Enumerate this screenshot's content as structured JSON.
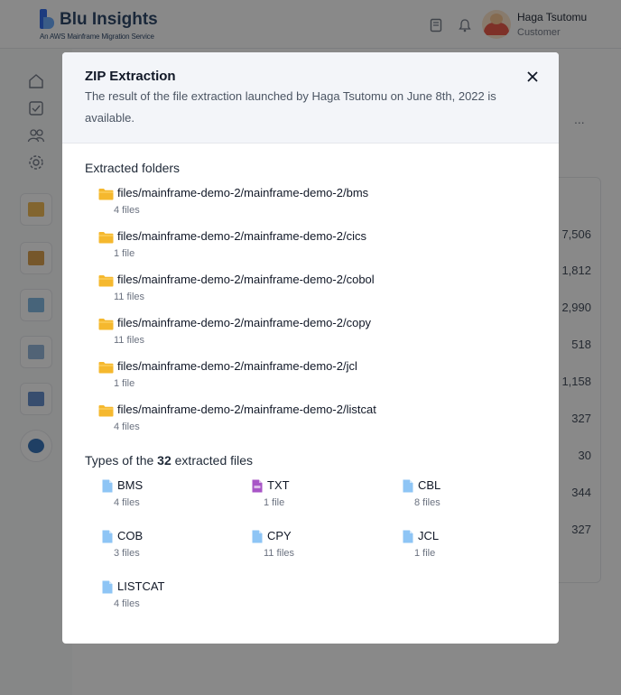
{
  "app": {
    "brand_title": "Blu Insights",
    "brand_subtitle": "An AWS Mainframe Migration Service",
    "user_name": "Haga Tsutomu",
    "user_role": "Customer",
    "background_values": [
      "7,506",
      "1,812",
      "2,990",
      "518",
      "1,158",
      "327",
      "30",
      "344",
      "327"
    ],
    "more_menu": "..."
  },
  "modal": {
    "title": "ZIP Extraction",
    "description": "The result of the file extraction launched by Haga Tsutomu on June 8th, 2022 is available.",
    "close_label": "×",
    "folders_title": "Extracted folders",
    "folders": [
      {
        "path": "files/mainframe-demo-2/mainframe-demo-2/bms",
        "count": "4 files"
      },
      {
        "path": "files/mainframe-demo-2/mainframe-demo-2/cics",
        "count": "1 file"
      },
      {
        "path": "files/mainframe-demo-2/mainframe-demo-2/cobol",
        "count": "11 files"
      },
      {
        "path": "files/mainframe-demo-2/mainframe-demo-2/copy",
        "count": "11 files"
      },
      {
        "path": "files/mainframe-demo-2/mainframe-demo-2/jcl",
        "count": "1 file"
      },
      {
        "path": "files/mainframe-demo-2/mainframe-demo-2/listcat",
        "count": "4 files"
      }
    ],
    "types_title_prefix": "Types of the",
    "types_total": "32",
    "types_title_suffix": "extracted files",
    "types": [
      {
        "name": "BMS",
        "count": "4 files",
        "icon": "file-icon"
      },
      {
        "name": "TXT",
        "count": "1 file",
        "icon": "txt-file-icon"
      },
      {
        "name": "CBL",
        "count": "8 files",
        "icon": "file-icon"
      },
      {
        "name": "COB",
        "count": "3 files",
        "icon": "file-icon"
      },
      {
        "name": "CPY",
        "count": "11 files",
        "icon": "file-icon"
      },
      {
        "name": "JCL",
        "count": "1 file",
        "icon": "file-icon"
      },
      {
        "name": "LISTCAT",
        "count": "4 files",
        "icon": "file-icon"
      }
    ]
  },
  "colors": {
    "folder": "#f5b82e",
    "file": "#8ec5f5",
    "txt_file": "#a855c7",
    "overlay": "#141414"
  }
}
